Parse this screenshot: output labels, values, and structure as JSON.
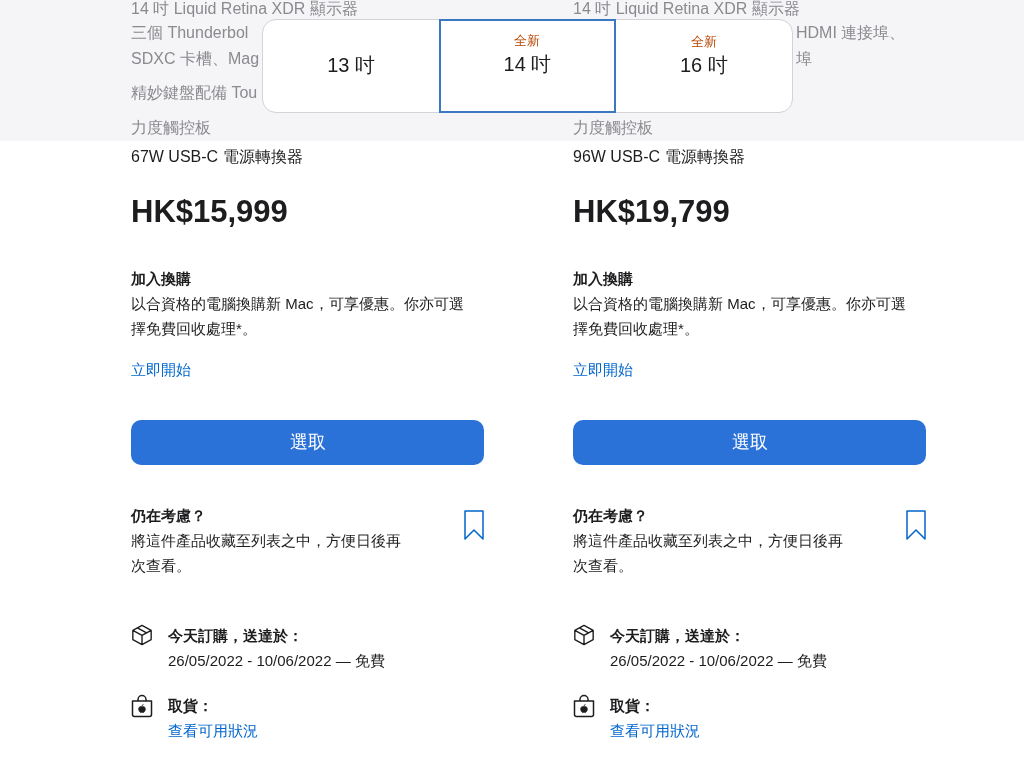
{
  "spec_rows": [
    {
      "left": "14 吋 Liquid Retina XDR 顯示器",
      "right": "14 吋 Liquid Retina XDR 顯示器"
    },
    {
      "left": "三個 Thunderbol",
      "right_tail": "HDMI 連接埠、"
    },
    {
      "left": "SDXC 卡槽、Mag",
      "right_tail": "埠"
    },
    {
      "left": "精妙鍵盤配備 Tou"
    },
    {
      "left": "力度觸控板",
      "right": "力度觸控板"
    }
  ],
  "size_picker": {
    "options": [
      {
        "label": "13 吋",
        "selected": false
      },
      {
        "label": "14 吋",
        "badge": "全新",
        "selected": true
      },
      {
        "label": "16 吋",
        "badge": "全新",
        "selected": false
      }
    ]
  },
  "products": [
    {
      "adapter": "67W USB-C 電源轉換器",
      "price": "HK$15,999",
      "trade_in": {
        "title": "加入換購",
        "text": "以合資格的電腦換購新 Mac，可享優惠。你亦可選擇免費回收處理*。",
        "link": "立即開始"
      },
      "select_button": "選取",
      "consider": {
        "title": "仍在考慮？",
        "text": "將這件產品收藏至列表之中，方便日後再次查看。"
      },
      "delivery": {
        "title": "今天訂購，送達於：",
        "dates": "26/05/2022 - 10/06/2022 — 免費"
      },
      "pickup": {
        "title": "取貨：",
        "link": "查看可用狀況"
      }
    },
    {
      "adapter": "96W USB-C 電源轉換器",
      "price": "HK$19,799",
      "trade_in": {
        "title": "加入換購",
        "text": "以合資格的電腦換購新 Mac，可享優惠。你亦可選擇免費回收處理*。",
        "link": "立即開始"
      },
      "select_button": "選取",
      "consider": {
        "title": "仍在考慮？",
        "text": "將這件產品收藏至列表之中，方便日後再次查看。"
      },
      "delivery": {
        "title": "今天訂購，送達於：",
        "dates": "26/05/2022 - 10/06/2022 — 免費"
      },
      "pickup": {
        "title": "取貨：",
        "link": "查看可用狀況"
      }
    }
  ]
}
